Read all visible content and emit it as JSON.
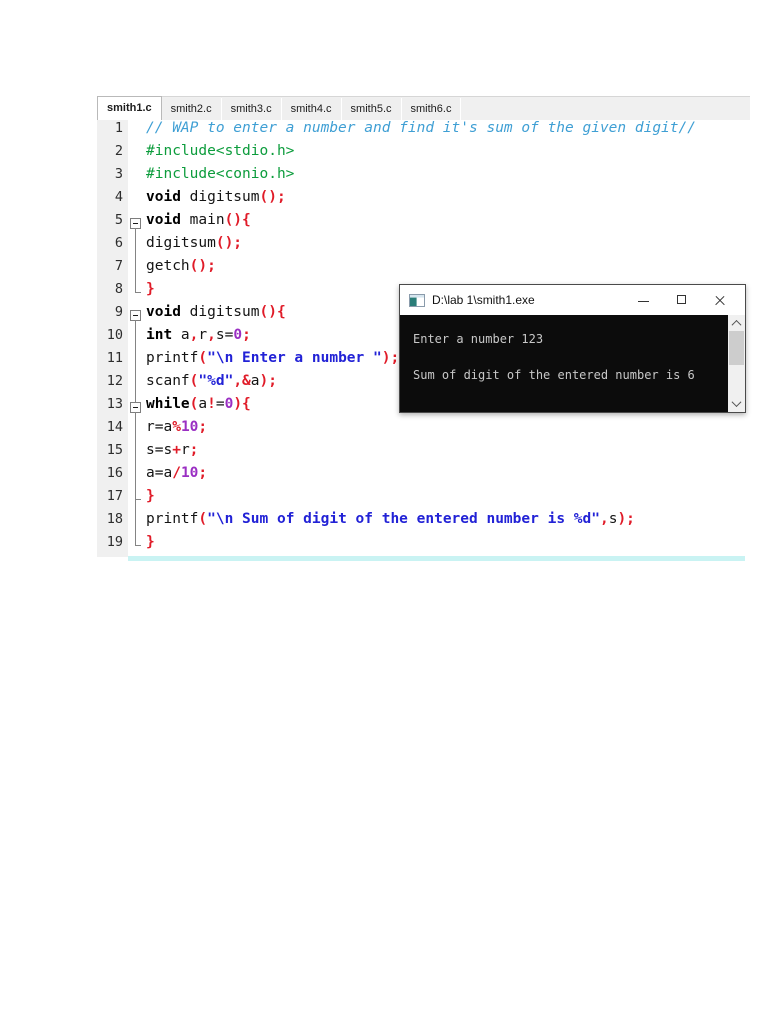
{
  "tab_bar": {
    "tabs": [
      {
        "label": "smith1.c",
        "active": true
      },
      {
        "label": "smith2.c",
        "active": false
      },
      {
        "label": "smith3.c",
        "active": false
      },
      {
        "label": "smith4.c",
        "active": false
      },
      {
        "label": "smith5.c",
        "active": false
      },
      {
        "label": "smith6.c",
        "active": false
      }
    ]
  },
  "editor": {
    "lines": [
      {
        "num": "1",
        "fold": "none",
        "tokens": [
          [
            "comment",
            "// WAP to enter a number and find it's sum of the given digit//"
          ]
        ]
      },
      {
        "num": "2",
        "fold": "none",
        "tokens": [
          [
            "include",
            "#include<stdio.h>"
          ]
        ]
      },
      {
        "num": "3",
        "fold": "none",
        "tokens": [
          [
            "include",
            "#include<conio.h>"
          ]
        ]
      },
      {
        "num": "4",
        "fold": "none",
        "tokens": [
          [
            "kw",
            "void"
          ],
          [
            "plain",
            " digitsum"
          ],
          [
            "red",
            "();"
          ]
        ]
      },
      {
        "num": "5",
        "fold": "open",
        "tokens": [
          [
            "kw",
            "void"
          ],
          [
            "plain",
            " main"
          ],
          [
            "red",
            "(){"
          ]
        ]
      },
      {
        "num": "6",
        "fold": "line",
        "tokens": [
          [
            "plain",
            "digitsum"
          ],
          [
            "red",
            "();"
          ]
        ]
      },
      {
        "num": "7",
        "fold": "line",
        "tokens": [
          [
            "plain",
            "getch"
          ],
          [
            "red",
            "();"
          ]
        ]
      },
      {
        "num": "8",
        "fold": "end",
        "tokens": [
          [
            "red",
            "}"
          ]
        ]
      },
      {
        "num": "9",
        "fold": "open",
        "tokens": [
          [
            "kw",
            "void"
          ],
          [
            "plain",
            " digitsum"
          ],
          [
            "red",
            "(){"
          ]
        ]
      },
      {
        "num": "10",
        "fold": "line",
        "tokens": [
          [
            "kw",
            "int"
          ],
          [
            "plain",
            " a"
          ],
          [
            "red",
            ","
          ],
          [
            "plain",
            "r"
          ],
          [
            "red",
            ","
          ],
          [
            "plain",
            "s="
          ],
          [
            "num",
            "0"
          ],
          [
            "red",
            ";"
          ]
        ]
      },
      {
        "num": "11",
        "fold": "line",
        "tokens": [
          [
            "plain",
            "printf"
          ],
          [
            "red",
            "("
          ],
          [
            "str",
            "\"\\n Enter a number \""
          ],
          [
            "red",
            ");"
          ]
        ]
      },
      {
        "num": "12",
        "fold": "line",
        "tokens": [
          [
            "plain",
            "scanf"
          ],
          [
            "red",
            "("
          ],
          [
            "str",
            "\"%d\""
          ],
          [
            "red",
            ",&"
          ],
          [
            "plain",
            "a"
          ],
          [
            "red",
            ");"
          ]
        ]
      },
      {
        "num": "13",
        "fold": "open2",
        "tokens": [
          [
            "kw",
            "while"
          ],
          [
            "red",
            "("
          ],
          [
            "plain",
            "a"
          ],
          [
            "red",
            "!"
          ],
          [
            "plain",
            "="
          ],
          [
            "num",
            "0"
          ],
          [
            "red",
            "){"
          ]
        ]
      },
      {
        "num": "14",
        "fold": "line",
        "tokens": [
          [
            "plain",
            "r=a"
          ],
          [
            "red",
            "%"
          ],
          [
            "num",
            "10"
          ],
          [
            "red",
            ";"
          ]
        ]
      },
      {
        "num": "15",
        "fold": "line",
        "tokens": [
          [
            "plain",
            "s=s"
          ],
          [
            "red",
            "+"
          ],
          [
            "plain",
            "r"
          ],
          [
            "red",
            ";"
          ]
        ]
      },
      {
        "num": "16",
        "fold": "line",
        "tokens": [
          [
            "plain",
            "a=a"
          ],
          [
            "red",
            "/"
          ],
          [
            "num",
            "10"
          ],
          [
            "red",
            ";"
          ]
        ]
      },
      {
        "num": "17",
        "fold": "tee",
        "tokens": [
          [
            "red",
            "}"
          ]
        ]
      },
      {
        "num": "18",
        "fold": "line",
        "tokens": [
          [
            "plain",
            "printf"
          ],
          [
            "red",
            "("
          ],
          [
            "str",
            "\"\\n Sum of digit of the entered number is %d\""
          ],
          [
            "red",
            ","
          ],
          [
            "plain",
            "s"
          ],
          [
            "red",
            ");"
          ]
        ]
      },
      {
        "num": "19",
        "fold": "end",
        "tokens": [
          [
            "red",
            "}"
          ]
        ]
      }
    ]
  },
  "console": {
    "title": "D:\\lab 1\\smith1.exe",
    "output_lines": [
      "Enter a number 123",
      "Sum of digit of the entered number is 6"
    ],
    "controls": [
      "minimize",
      "maximize",
      "close"
    ]
  },
  "colors": {
    "comment": "#3f9fd4",
    "include": "#0c9c3c",
    "keyword": "#000000",
    "operator_red": "#e01b28",
    "number": "#9a2fc3",
    "string": "#2222d6",
    "console_bg": "#0c0c0c",
    "console_text": "#c8c8c8",
    "gutter_bg": "#f0f0f0",
    "currentline": "#c9f3f3"
  }
}
